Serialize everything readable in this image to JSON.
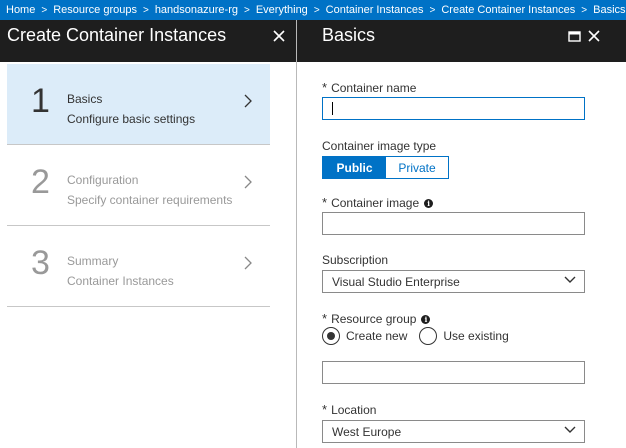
{
  "breadcrumb": {
    "items": [
      "Home",
      "Resource groups",
      "handsonazure-rg",
      "Everything",
      "Container Instances",
      "Create Container Instances",
      "Basics"
    ]
  },
  "left_blade": {
    "title": "Create Container Instances",
    "steps": [
      {
        "number": "1",
        "title": "Basics",
        "subtitle": "Configure basic settings",
        "state": "active"
      },
      {
        "number": "2",
        "title": "Configuration",
        "subtitle": "Specify container requirements",
        "state": "inactive"
      },
      {
        "number": "3",
        "title": "Summary",
        "subtitle": "Container Instances",
        "state": "inactive"
      }
    ]
  },
  "right_blade": {
    "title": "Basics"
  },
  "form": {
    "required_mark": "*",
    "container_name": {
      "label": "Container name",
      "value": ""
    },
    "image_type": {
      "label": "Container image type",
      "options": [
        "Public",
        "Private"
      ],
      "selected": "Public"
    },
    "container_image": {
      "label": "Container image",
      "value": ""
    },
    "subscription": {
      "label": "Subscription",
      "value": "Visual Studio Enterprise"
    },
    "resource_group": {
      "label": "Resource group",
      "options": [
        "Create new",
        "Use existing"
      ],
      "selected": "Create new",
      "value": ""
    },
    "location": {
      "label": "Location",
      "value": "West Europe"
    }
  },
  "icons": {
    "close": "close-icon",
    "maximize": "maximize-icon",
    "chevron_right": "chevron-right-icon",
    "chevron_down": "chevron-down-icon",
    "info": "info-icon",
    "info_glyph": "i"
  },
  "colors": {
    "accent": "#0072c6",
    "header_bg": "#1e1e1e",
    "active_step_bg": "#dcecf9"
  }
}
